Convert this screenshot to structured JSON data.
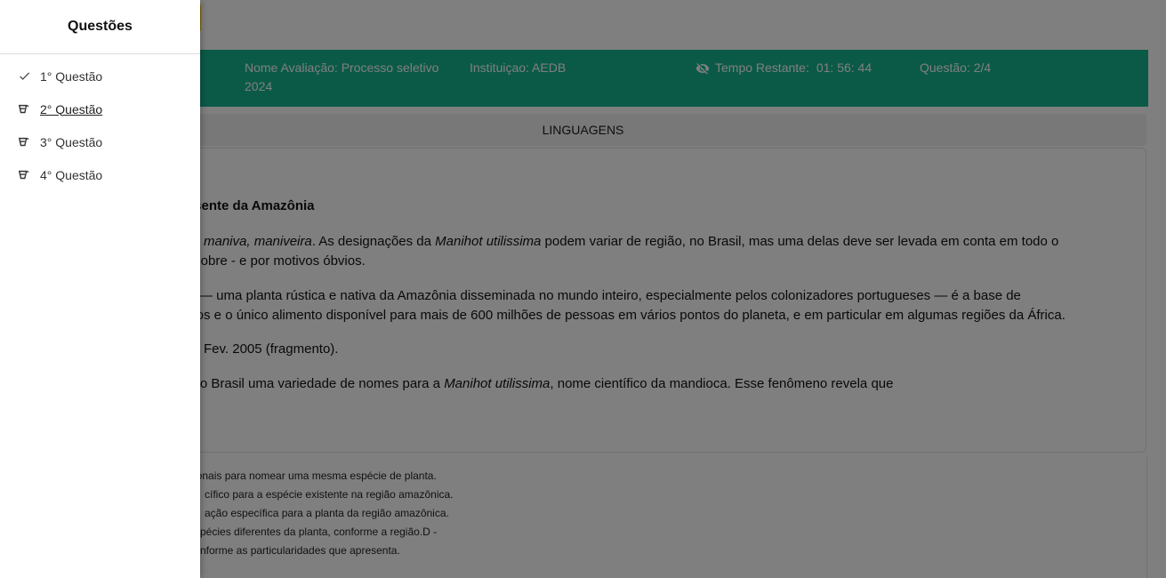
{
  "drawer": {
    "title": "Questões",
    "items": [
      {
        "label": "1° Questão",
        "icon": "check-icon",
        "state": "answered"
      },
      {
        "label": "2° Questão",
        "icon": "pending-icon",
        "state": "current"
      },
      {
        "label": "3° Questão",
        "icon": "pending-icon",
        "state": "pending"
      },
      {
        "label": "4° Questão",
        "icon": "pending-icon",
        "state": "pending"
      }
    ]
  },
  "header": {
    "nome_avaliacao": "Nome Avaliação: Processo seletivo 2024",
    "instituicao": "Instituiçao: AEDB",
    "tempo_label": "Tempo Restante:",
    "tempo_value": "01: 56: 44",
    "questao": "Questão: 2/4",
    "color": "#16b48f"
  },
  "subject": "LINGUAGENS",
  "question": {
    "title_fragment": "resente da Amazônia",
    "p1a_it": "ira, maniva, maniveira",
    "p1a_rest": ". As designações da ",
    "p1a_it2": "Manihot utilissima",
    "p1a_end": " podem variar de região, no Brasil, mas uma delas deve ser levada em conta em todo o",
    "p1b": "e-pobre - e por motivos óbvios.",
    "p2a": "ca — uma planta rústica e nativa da Amazônia disseminada no mundo inteiro, especialmente pelos colonizadores portugueses — é a base de",
    "p2b": "eiros e o único alimento disponível para mais de 600 milhões de pessoas em vários pontos do planeta, e em particular em algumas regiões da África.",
    "source": "Fev. 2005 (fragmento).",
    "prompt_a": "á no Brasil uma variedade de nomes para a ",
    "prompt_it": "Manihot utilissima",
    "prompt_b": ", nome científico da mandioca. Esse fenômeno revela que"
  },
  "answers": [
    "ionais para nomear uma mesma espécie de planta.",
    "cífico para a espécie existente na região amazônica.",
    "ação específica para a planta da região amazônica.",
    "pécies diferentes da planta, conforme a região.D -",
    "nforme as particularidades que apresenta."
  ]
}
